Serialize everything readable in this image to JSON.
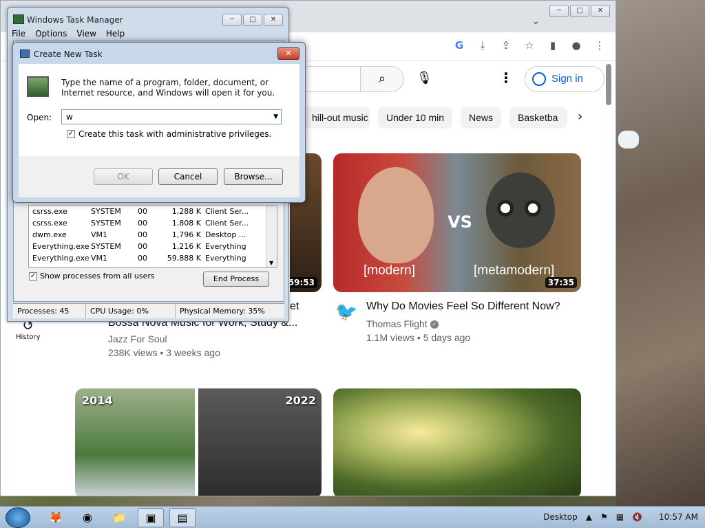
{
  "chrome": {
    "window_buttons": [
      "─",
      "□",
      "✕"
    ],
    "tab_dropdown": "⌄",
    "omnibox_icons": [
      "google-lens-icon",
      "download-icon",
      "share-icon",
      "bookmark-star-icon",
      "side-panel-icon",
      "profile-icon",
      "menu-icon"
    ],
    "youtube": {
      "sign_in": "Sign in",
      "chips": [
        "hill-out music",
        "Under 10 min",
        "News",
        "Basketba"
      ],
      "history_label": "History",
      "videos": [
        {
          "overlay_vs": "VS",
          "overlay_left": "[modern]",
          "overlay_right": "[metamodern]",
          "duration": "37:35",
          "title": "Why Do Movies Feel So Different Now?",
          "channel": "Thomas Flight",
          "meta": "1.1M views • 5 days ago"
        },
        {
          "duration": "59:53",
          "title": "Bossa Nova Music for Work, Study &...",
          "title_fragment": "et",
          "channel": "Jazz For Soul",
          "meta": "238K views • 3 weeks ago"
        },
        {
          "year_left": "2014",
          "year_right": "2022"
        }
      ]
    }
  },
  "taskmanager": {
    "title": "Windows Task Manager",
    "menu": [
      "File",
      "Options",
      "View",
      "Help"
    ],
    "processes": [
      {
        "name": "csrss.exe",
        "user": "SYSTEM",
        "cpu": "00",
        "mem": "1,288 K",
        "desc": "Client Ser..."
      },
      {
        "name": "csrss.exe",
        "user": "SYSTEM",
        "cpu": "00",
        "mem": "1,808 K",
        "desc": "Client Ser..."
      },
      {
        "name": "dwm.exe",
        "user": "VM1",
        "cpu": "00",
        "mem": "1,796 K",
        "desc": "Desktop ..."
      },
      {
        "name": "Everything.exe",
        "user": "SYSTEM",
        "cpu": "00",
        "mem": "1,216 K",
        "desc": "Everything"
      },
      {
        "name": "Everything.exe",
        "user": "VM1",
        "cpu": "00",
        "mem": "59,888 K",
        "desc": "Everything"
      }
    ],
    "show_all_label": "Show processes from all users",
    "end_process": "End Process",
    "status": {
      "processes": "Processes: 45",
      "cpu": "CPU Usage: 0%",
      "memory": "Physical Memory: 35%"
    }
  },
  "dialog": {
    "title": "Create New Task",
    "description": "Type the name of a program, folder, document, or Internet resource, and Windows will open it for you.",
    "open_label": "Open:",
    "open_value": "w",
    "admin_label": "Create this task with administrative privileges.",
    "ok": "OK",
    "cancel": "Cancel",
    "browse": "Browse..."
  },
  "taskbar": {
    "desktop_label": "Desktop",
    "clock": "10:57 AM"
  }
}
